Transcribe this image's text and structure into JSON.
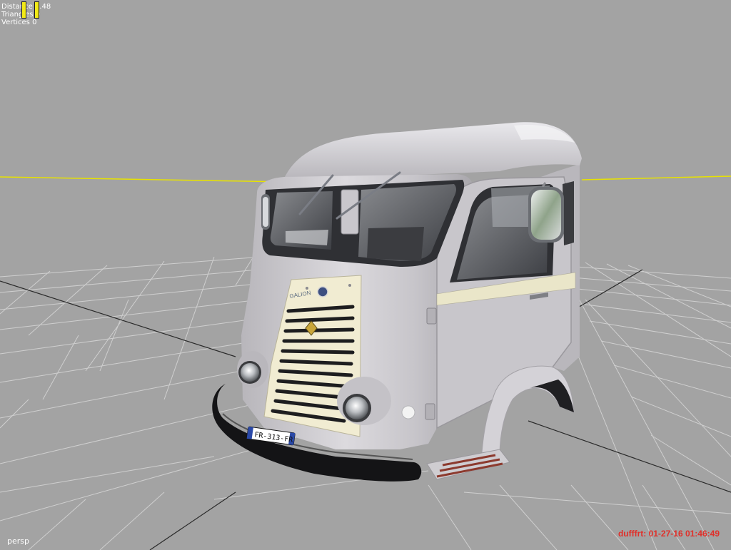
{
  "hud": {
    "distance_label": "Distance",
    "distance_value": "5.48",
    "triangles_label": "Triangles",
    "triangles_value": "0",
    "vertices_label": "Vertices",
    "vertices_value": "0"
  },
  "camera": {
    "label": "persp"
  },
  "plate": {
    "text": "FR-313-FR"
  },
  "badge": {
    "text": "GALION"
  },
  "stamp": {
    "text": "dufffrt: 01-27-16 01:46:49",
    "color": "#e0302a"
  },
  "colors": {
    "background": "#a3a3a3",
    "grid": "#cfcfcf",
    "grid_axis": "#2a2a2a",
    "horizon": "#e7e200",
    "cab_body": "#c9c7cc",
    "grille_panel": "#f1ecd2",
    "stripe": "#eae6c9"
  }
}
